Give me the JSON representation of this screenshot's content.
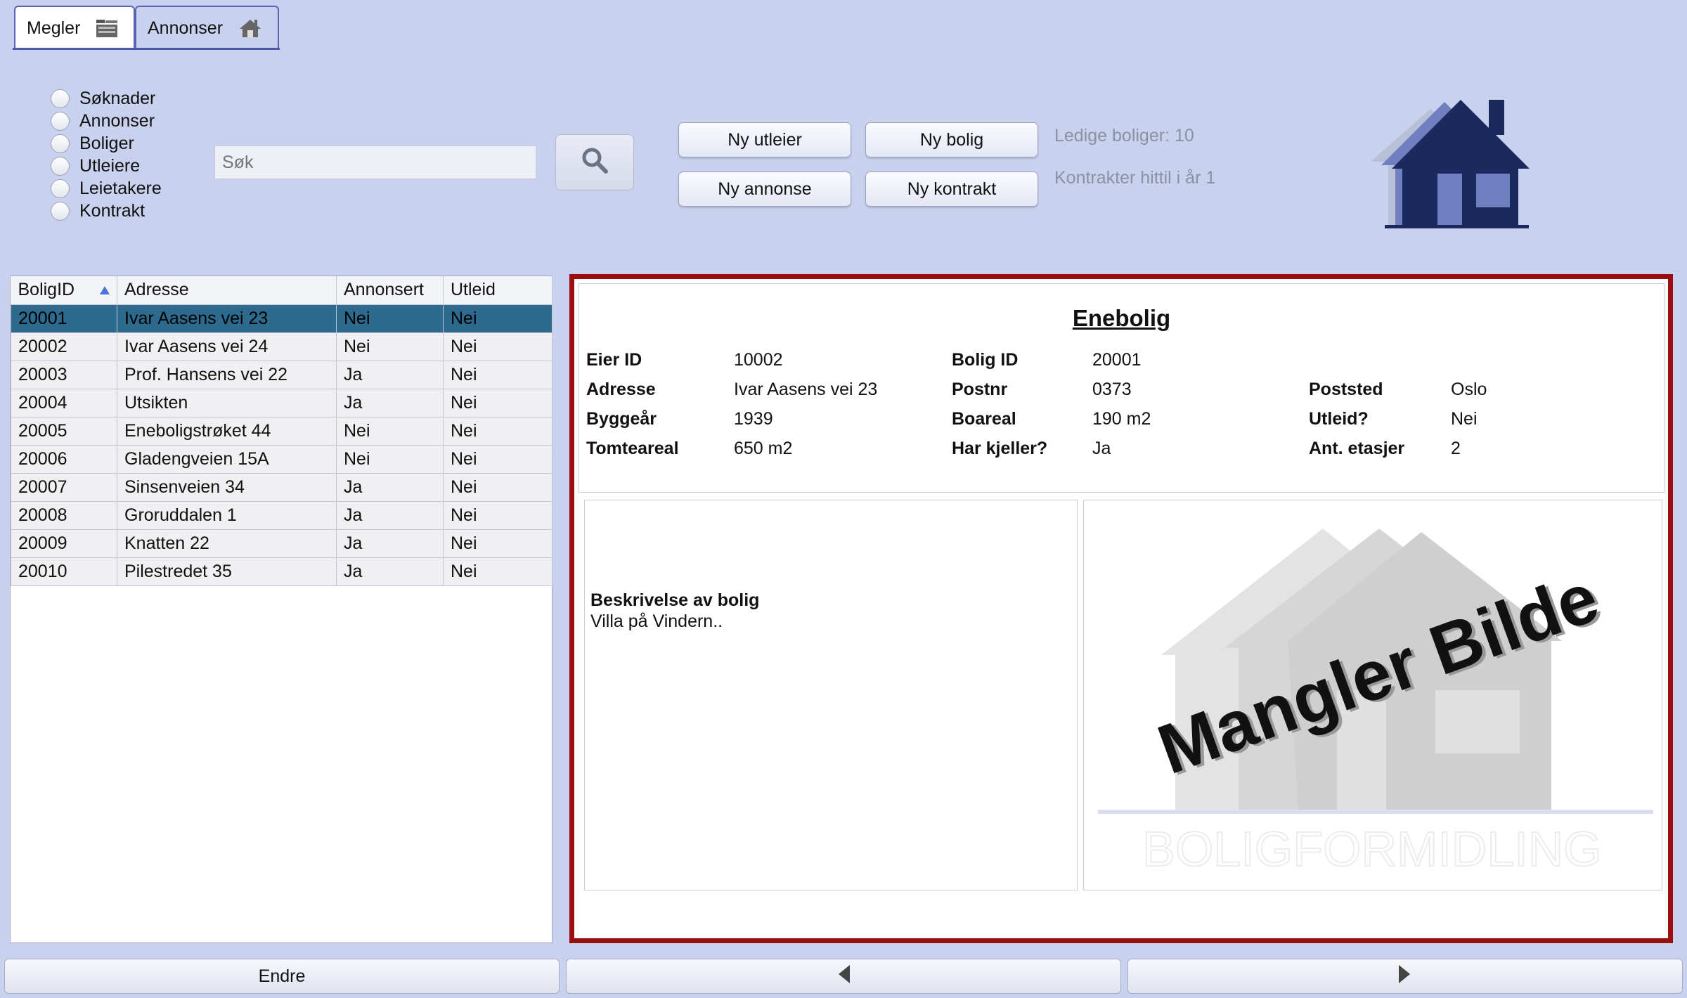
{
  "tabs": [
    {
      "label": "Megler",
      "icon": "building-icon"
    },
    {
      "label": "Annonser",
      "icon": "house-icon"
    }
  ],
  "radios": [
    "Søknader",
    "Annonser",
    "Boliger",
    "Utleiere",
    "Leietakere",
    "Kontrakt"
  ],
  "search": {
    "placeholder": "Søk"
  },
  "actions": {
    "ny_utleier": "Ny utleier",
    "ny_bolig": "Ny bolig",
    "ny_annonse": "Ny annonse",
    "ny_kontrakt": "Ny kontrakt"
  },
  "info": {
    "ledige": "Ledige boliger: 10",
    "kontrakter": "Kontrakter hittil i år 1"
  },
  "colors": {
    "accent": "#9c0d10",
    "selected_row": "#2e6a8d",
    "logo": "#1a2a5e"
  },
  "table": {
    "headers": [
      "BoligID",
      "Adresse",
      "Annonsert",
      "Utleid"
    ],
    "rows": [
      [
        "20001",
        "Ivar Aasens vei 23",
        "Nei",
        "Nei"
      ],
      [
        "20002",
        "Ivar Aasens vei 24",
        "Nei",
        "Nei"
      ],
      [
        "20003",
        "Prof. Hansens vei 22",
        "Ja",
        "Nei"
      ],
      [
        "20004",
        "Utsikten",
        "Ja",
        "Nei"
      ],
      [
        "20005",
        "Eneboligstrøket 44",
        "Nei",
        "Nei"
      ],
      [
        "20006",
        "Gladengveien 15A",
        "Nei",
        "Nei"
      ],
      [
        "20007",
        "Sinsenveien 34",
        "Ja",
        "Nei"
      ],
      [
        "20008",
        "Groruddalen 1",
        "Ja",
        "Nei"
      ],
      [
        "20009",
        "Knatten 22",
        "Ja",
        "Nei"
      ],
      [
        "20010",
        "Pilestredet 35",
        "Ja",
        "Nei"
      ]
    ]
  },
  "detail": {
    "title": "Enebolig",
    "eier_id_label": "Eier ID",
    "eier_id": "10002",
    "bolig_id_label": "Bolig ID",
    "bolig_id": "20001",
    "adresse_label": "Adresse",
    "adresse": "Ivar Aasens vei 23",
    "postnr_label": "Postnr",
    "postnr": "0373",
    "poststed_label": "Poststed",
    "poststed": "Oslo",
    "byggear_label": "Byggeår",
    "byggear": "1939",
    "boareal_label": "Boareal",
    "boareal": "190 m2",
    "utleid_label": "Utleid?",
    "utleid": "Nei",
    "tomteareal_label": "Tomteareal",
    "tomteareal": "650 m2",
    "kjeller_label": "Har kjeller?",
    "kjeller": "Ja",
    "etasjer_label": "Ant. etasjer",
    "etasjer": "2",
    "beskrivelse_label": "Beskrivelse av bolig",
    "beskrivelse": "Villa på Vindern..",
    "image_placeholder": "Mangler Bilde",
    "image_watermark": "BOLIGFORMIDLING"
  },
  "bottom": {
    "endre": "Endre"
  }
}
